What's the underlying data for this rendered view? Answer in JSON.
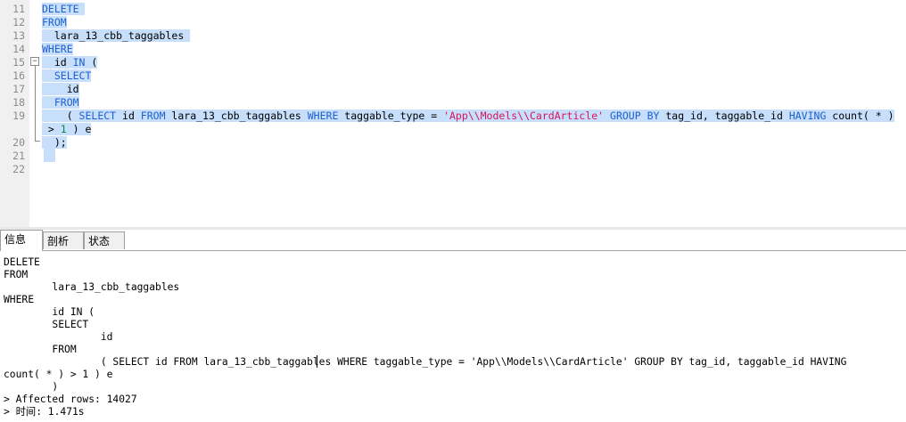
{
  "editor": {
    "line_numbers": [
      "11",
      "12",
      "13",
      "14",
      "15",
      "16",
      "17",
      "18",
      "19",
      "20",
      "21",
      "22"
    ],
    "fold_toggle": "−",
    "lines": [
      {
        "ln": "11",
        "tokens": [
          {
            "t": "DELETE",
            "c": "kw"
          },
          {
            "t": " ",
            "c": "plain"
          }
        ]
      },
      {
        "ln": "12",
        "tokens": [
          {
            "t": "FROM",
            "c": "kw"
          }
        ]
      },
      {
        "ln": "13",
        "tokens": [
          {
            "t": "  lara_13_cbb_taggables ",
            "c": "plain"
          }
        ]
      },
      {
        "ln": "14",
        "tokens": [
          {
            "t": "WHERE",
            "c": "kw"
          }
        ]
      },
      {
        "ln": "15",
        "tokens": [
          {
            "t": "  id ",
            "c": "plain"
          },
          {
            "t": "IN",
            "c": "kw"
          },
          {
            "t": " (",
            "c": "plain"
          }
        ]
      },
      {
        "ln": "16",
        "tokens": [
          {
            "t": "  ",
            "c": "plain"
          },
          {
            "t": "SELECT",
            "c": "kw"
          }
        ]
      },
      {
        "ln": "17",
        "tokens": [
          {
            "t": "    id",
            "c": "plain"
          }
        ]
      },
      {
        "ln": "18",
        "tokens": [
          {
            "t": "  ",
            "c": "plain"
          },
          {
            "t": "FROM",
            "c": "kw"
          }
        ]
      },
      {
        "ln": "19",
        "tokens": [
          {
            "t": "    ( ",
            "c": "plain"
          },
          {
            "t": "SELECT",
            "c": "kw"
          },
          {
            "t": " id ",
            "c": "plain"
          },
          {
            "t": "FROM",
            "c": "kw"
          },
          {
            "t": " lara_13_cbb_taggables ",
            "c": "plain"
          },
          {
            "t": "WHERE",
            "c": "kw"
          },
          {
            "t": " taggable_type = ",
            "c": "plain"
          },
          {
            "t": "'App\\\\Models\\\\CardArticle'",
            "c": "str"
          },
          {
            "t": " ",
            "c": "plain"
          },
          {
            "t": "GROUP BY",
            "c": "kw"
          },
          {
            "t": " tag_id, taggable_id ",
            "c": "plain"
          },
          {
            "t": "HAVING",
            "c": "kw"
          },
          {
            "t": " count( * )",
            "c": "plain"
          }
        ]
      },
      {
        "ln": "",
        "tokens": [
          {
            "t": " > ",
            "c": "plain"
          },
          {
            "t": "1",
            "c": "num"
          },
          {
            "t": " ) e",
            "c": "plain"
          }
        ]
      },
      {
        "ln": "20",
        "tokens": [
          {
            "t": "  );",
            "c": "plain"
          }
        ]
      },
      {
        "ln": "21",
        "tokens": []
      },
      {
        "ln": "22",
        "tokens": []
      }
    ]
  },
  "tabs": [
    {
      "label": "信息",
      "active": true
    },
    {
      "label": "剖析",
      "active": false
    },
    {
      "label": "状态",
      "active": false
    }
  ],
  "output": {
    "lines": [
      "DELETE",
      "FROM",
      "        lara_13_cbb_taggables",
      "WHERE",
      "        id IN (",
      "        SELECT",
      "                id",
      "        FROM",
      "                ( SELECT id FROM lara_13_cbb_taggables WHERE taggable_type = 'App\\\\Models\\\\CardArticle' GROUP BY tag_id, taggable_id HAVING",
      "count( * ) > 1 ) e",
      "        )",
      "> Affected rows: 14027",
      "> 时间: 1.471s"
    ]
  }
}
